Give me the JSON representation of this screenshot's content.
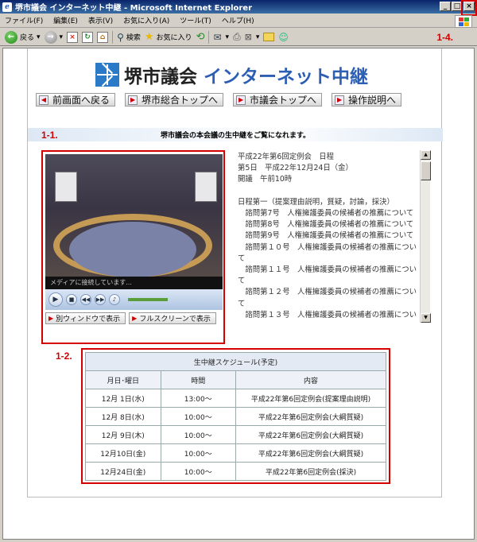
{
  "window": {
    "title": "堺市議会 インターネット中継 - Microsoft Internet Explorer",
    "buttons": {
      "minimize": "_",
      "maximize": "□",
      "close": "×"
    }
  },
  "menu": [
    "ファイル(F)",
    "編集(E)",
    "表示(V)",
    "お気に入り(A)",
    "ツール(T)",
    "ヘルプ(H)"
  ],
  "toolbar": {
    "back": "戻る",
    "search": "検索",
    "favorites": "お気に入り"
  },
  "annotations": {
    "a11": "1-1.",
    "a12": "1-2.",
    "a14": "1-4."
  },
  "site": {
    "logo_part1": "堺市議会",
    "logo_part2": "インターネット中継",
    "nav": [
      "前画面へ戻る",
      "堺市総合トップへ",
      "市議会トップへ",
      "操作説明へ"
    ],
    "intro": "堺市議会の本会議の生中継をご覧になれます。"
  },
  "player": {
    "status": "メディアに接続しています...",
    "open_window": "別ウィンドウで表示",
    "fullscreen": "フルスクリーンで表示"
  },
  "agenda": {
    "lines": [
      "平成22年第6回定例会　日程",
      "第5日　平成22年12月24日（金）",
      "開議　午前10時",
      "",
      "日程第一（提案理由説明，質疑，討論，採決）",
      "　諮問第7号　人権擁護委員の候補者の推薦について",
      "　諮問第8号　人権擁護委員の候補者の推薦について",
      "　諮問第9号　人権擁護委員の候補者の推薦について",
      "　諮問第１０号　人権擁護委員の候補者の推薦につい",
      "て",
      "　諮問第１１号　人権擁護委員の候補者の推薦につい",
      "て",
      "　諮問第１２号　人権擁護委員の候補者の推薦につい",
      "て",
      "　諮問第１３号　人権擁護委員の候補者の推薦につい"
    ]
  },
  "schedule": {
    "caption": "生中継スケジュール(予定)",
    "headers": [
      "月日･曜日",
      "時間",
      "内容"
    ],
    "rows": [
      [
        "12月 1日(水)",
        "13:00～",
        "平成22年第6回定例会(提案理由説明)"
      ],
      [
        "12月 8日(水)",
        "10:00～",
        "平成22年第6回定例会(大綱質疑)"
      ],
      [
        "12月 9日(木)",
        "10:00～",
        "平成22年第6回定例会(大綱質疑)"
      ],
      [
        "12月10日(金)",
        "10:00～",
        "平成22年第6回定例会(大綱質疑)"
      ],
      [
        "12月24日(金)",
        "10:00～",
        "平成22年第6回定例会(採決)"
      ]
    ]
  }
}
